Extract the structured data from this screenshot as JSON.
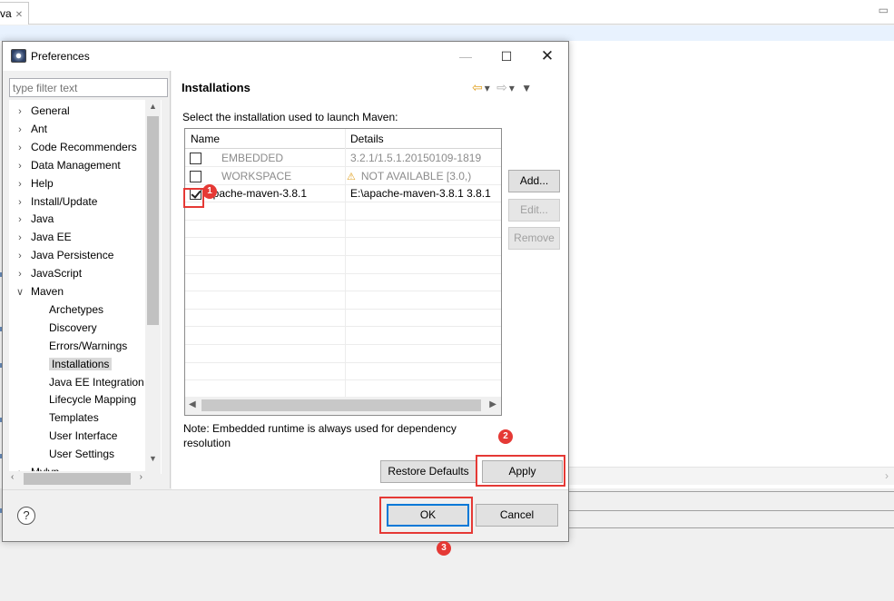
{
  "workbench": {
    "editor_tab_label": "va",
    "editor_tab_close": "✕",
    "minimize_glyph": "▭"
  },
  "dialog": {
    "title": "Preferences",
    "window_controls": {
      "minimize": "—",
      "maximize": "☐",
      "close": "✕"
    },
    "filter": {
      "placeholder": "type filter text"
    },
    "tree": [
      {
        "label": "General",
        "expanded": false
      },
      {
        "label": "Ant",
        "expanded": false
      },
      {
        "label": "Code Recommenders",
        "expanded": false
      },
      {
        "label": "Data Management",
        "expanded": false
      },
      {
        "label": "Help",
        "expanded": false
      },
      {
        "label": "Install/Update",
        "expanded": false
      },
      {
        "label": "Java",
        "expanded": false
      },
      {
        "label": "Java EE",
        "expanded": false
      },
      {
        "label": "Java Persistence",
        "expanded": false
      },
      {
        "label": "JavaScript",
        "expanded": false
      },
      {
        "label": "Maven",
        "expanded": true
      },
      {
        "label": "Archetypes",
        "child": true
      },
      {
        "label": "Discovery",
        "child": true
      },
      {
        "label": "Errors/Warnings",
        "child": true
      },
      {
        "label": "Installations",
        "child": true,
        "selected": true
      },
      {
        "label": "Java EE Integration",
        "child": true
      },
      {
        "label": "Lifecycle Mapping",
        "child": true
      },
      {
        "label": "Templates",
        "child": true
      },
      {
        "label": "User Interface",
        "child": true
      },
      {
        "label": "User Settings",
        "child": true
      },
      {
        "label": "Mylyn",
        "expanded": false
      }
    ],
    "page": {
      "title": "Installations",
      "description": "Select the installation used to launch Maven:",
      "columns": [
        "Name",
        "Details"
      ],
      "rows": [
        {
          "checked": false,
          "name": "EMBEDDED",
          "details": "3.2.1/1.5.1.20150109-1819",
          "dimmed": true,
          "warning": false
        },
        {
          "checked": false,
          "name": "WORKSPACE",
          "details": "NOT AVAILABLE [3.0,)",
          "dimmed": true,
          "warning": true
        },
        {
          "checked": true,
          "name": "apache-maven-3.8.1",
          "details": "E:\\apache-maven-3.8.1 3.8.1",
          "dimmed": false,
          "warning": false
        }
      ],
      "side_buttons": {
        "add": "Add...",
        "edit": "Edit...",
        "remove": "Remove"
      },
      "note": "Note: Embedded runtime is always used for dependency resolution",
      "restore_defaults": "Restore Defaults",
      "apply": "Apply"
    },
    "footer": {
      "help": "?",
      "ok": "OK",
      "cancel": "Cancel"
    }
  },
  "annotations": {
    "step1": "1",
    "step2": "2",
    "step3": "3"
  },
  "colors": {
    "highlight": "#e53935",
    "focus": "#0078d7",
    "selection": "#d9d9d9"
  }
}
